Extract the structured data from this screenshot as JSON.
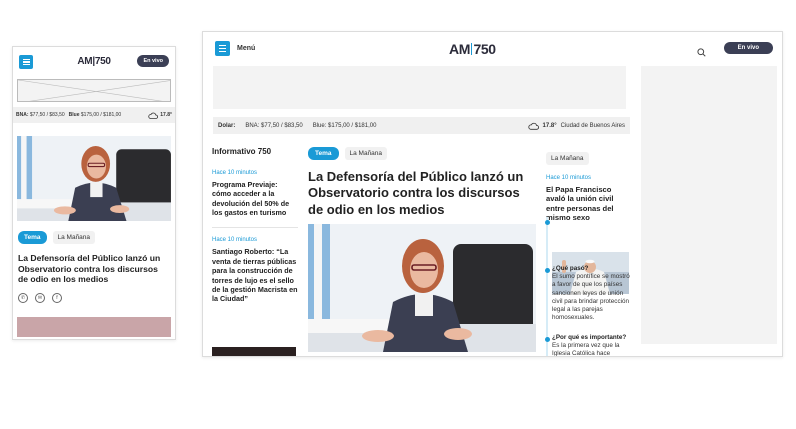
{
  "brand": {
    "logo": "AM|750",
    "logo_left": "AM",
    "logo_right": "750"
  },
  "header": {
    "menu_label": "Menú",
    "live_label": "En vivo"
  },
  "ticker": {
    "dolar_label": "Dolar:",
    "bna": "BNA: $77,50 / $83,50",
    "bna_mobile_label": "BNA:",
    "bna_mobile_value": "$77,50 / $83,50",
    "blue": "Blue: $175,00 / $181,00",
    "blue_mobile_label": "Blue",
    "blue_mobile_value": "$175,00 / $181,00",
    "temperature": "17.8°",
    "city": "Ciudad de Buenos Aires"
  },
  "main_article": {
    "tag": "Tema",
    "section": "La Mañana",
    "title": "La Defensoría del Público lanzó un Observatorio contra los discursos de odio en los medios"
  },
  "informativo": {
    "title": "Informativo 750",
    "items": [
      {
        "time": "Hace 10 minutos",
        "headline": "Programa Previaje: cómo acceder a la devolución del 50% de los gastos en turismo"
      },
      {
        "time": "Hace 10 minutos",
        "headline": "Santiago Roberto: “La venta de tierras públicas para la construcción de torres de lujo es el sello de la gestión Macrista en la Ciudad”"
      }
    ]
  },
  "right_article": {
    "section": "La Mañana",
    "time": "Hace 10 minutos",
    "title": "El Papa Francisco avaló la unión civil entre personas del mismo sexo",
    "qa": [
      {
        "question": "¿Qué pasó?",
        "answer": "El sumo pontífice se mostró a favor de que los países sancionen leyes de unión civil para brindar protección legal a las parejas homosexuales."
      },
      {
        "question": "¿Por qué es importante?",
        "answer": "Es la primera vez que la Iglesia Católica hace"
      }
    ]
  },
  "colors": {
    "accent": "#1a9ad6",
    "live_button": "#3b3f55",
    "ticker_bg": "#f0f0f0"
  },
  "icons": [
    "menu-icon",
    "search-icon",
    "cloud-icon",
    "whatsapp-icon",
    "email-icon",
    "facebook-icon"
  ]
}
